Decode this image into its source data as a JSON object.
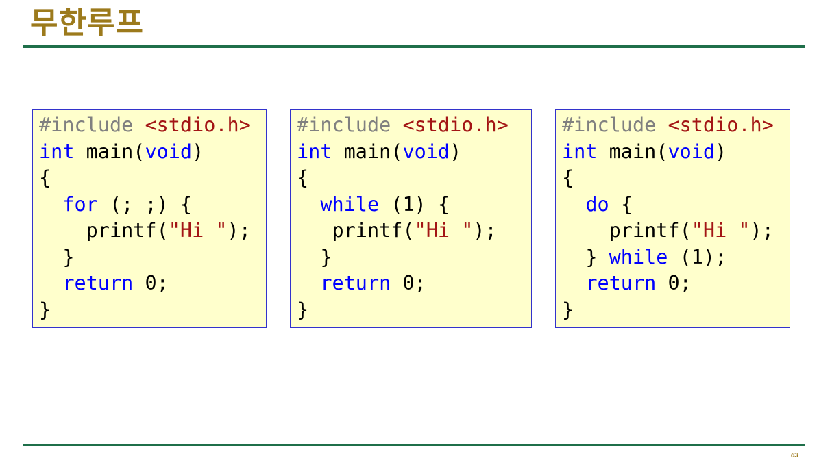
{
  "slide": {
    "title": "무한루프",
    "page_number": "63"
  },
  "colors": {
    "title": "#9C7A1C",
    "rule": "#1F6F4A",
    "box_background": "#FFFFCC",
    "box_border": "#3333CC",
    "keyword": "#0000FF",
    "string": "#A31515",
    "preprocessor": "#808080"
  },
  "code_boxes": [
    {
      "name": "for",
      "lines": [
        [
          {
            "t": "#include ",
            "c": "pp"
          },
          {
            "t": "<stdio.h>",
            "c": "inc"
          }
        ],
        [
          {
            "t": "int",
            "c": "kw"
          },
          {
            "t": " main(",
            "c": "txt"
          },
          {
            "t": "void",
            "c": "kw"
          },
          {
            "t": ")",
            "c": "txt"
          }
        ],
        [
          {
            "t": "{",
            "c": "txt"
          }
        ],
        [
          {
            "t": "  ",
            "c": "txt"
          },
          {
            "t": "for",
            "c": "kw"
          },
          {
            "t": " (; ;) {",
            "c": "txt"
          }
        ],
        [
          {
            "t": "    printf(",
            "c": "txt"
          },
          {
            "t": "\"Hi \"",
            "c": "str"
          },
          {
            "t": ");",
            "c": "txt"
          }
        ],
        [
          {
            "t": "  }",
            "c": "txt"
          }
        ],
        [
          {
            "t": "  ",
            "c": "txt"
          },
          {
            "t": "return",
            "c": "kw"
          },
          {
            "t": " 0;",
            "c": "txt"
          }
        ],
        [
          {
            "t": "}",
            "c": "txt"
          }
        ]
      ]
    },
    {
      "name": "while",
      "lines": [
        [
          {
            "t": "#include ",
            "c": "pp"
          },
          {
            "t": "<stdio.h>",
            "c": "inc"
          }
        ],
        [
          {
            "t": "int",
            "c": "kw"
          },
          {
            "t": " main(",
            "c": "txt"
          },
          {
            "t": "void",
            "c": "kw"
          },
          {
            "t": ")",
            "c": "txt"
          }
        ],
        [
          {
            "t": "{",
            "c": "txt"
          }
        ],
        [
          {
            "t": "  ",
            "c": "txt"
          },
          {
            "t": "while",
            "c": "kw"
          },
          {
            "t": " (1) {",
            "c": "txt"
          }
        ],
        [
          {
            "t": "   printf(",
            "c": "txt"
          },
          {
            "t": "\"Hi \"",
            "c": "str"
          },
          {
            "t": ");",
            "c": "txt"
          }
        ],
        [
          {
            "t": "  }",
            "c": "txt"
          }
        ],
        [
          {
            "t": "  ",
            "c": "txt"
          },
          {
            "t": "return",
            "c": "kw"
          },
          {
            "t": " 0;",
            "c": "txt"
          }
        ],
        [
          {
            "t": "}",
            "c": "txt"
          }
        ]
      ]
    },
    {
      "name": "do-while",
      "lines": [
        [
          {
            "t": "#include ",
            "c": "pp"
          },
          {
            "t": "<stdio.h>",
            "c": "inc"
          }
        ],
        [
          {
            "t": "int",
            "c": "kw"
          },
          {
            "t": " main(",
            "c": "txt"
          },
          {
            "t": "void",
            "c": "kw"
          },
          {
            "t": ")",
            "c": "txt"
          }
        ],
        [
          {
            "t": "{",
            "c": "txt"
          }
        ],
        [
          {
            "t": "  ",
            "c": "txt"
          },
          {
            "t": "do",
            "c": "kw"
          },
          {
            "t": " {",
            "c": "txt"
          }
        ],
        [
          {
            "t": "    printf(",
            "c": "txt"
          },
          {
            "t": "\"Hi \"",
            "c": "str"
          },
          {
            "t": ");",
            "c": "txt"
          }
        ],
        [
          {
            "t": "  } ",
            "c": "txt"
          },
          {
            "t": "while",
            "c": "kw"
          },
          {
            "t": " (1);",
            "c": "txt"
          }
        ],
        [
          {
            "t": "  ",
            "c": "txt"
          },
          {
            "t": "return",
            "c": "kw"
          },
          {
            "t": " 0;",
            "c": "txt"
          }
        ],
        [
          {
            "t": "}",
            "c": "txt"
          }
        ]
      ]
    }
  ]
}
